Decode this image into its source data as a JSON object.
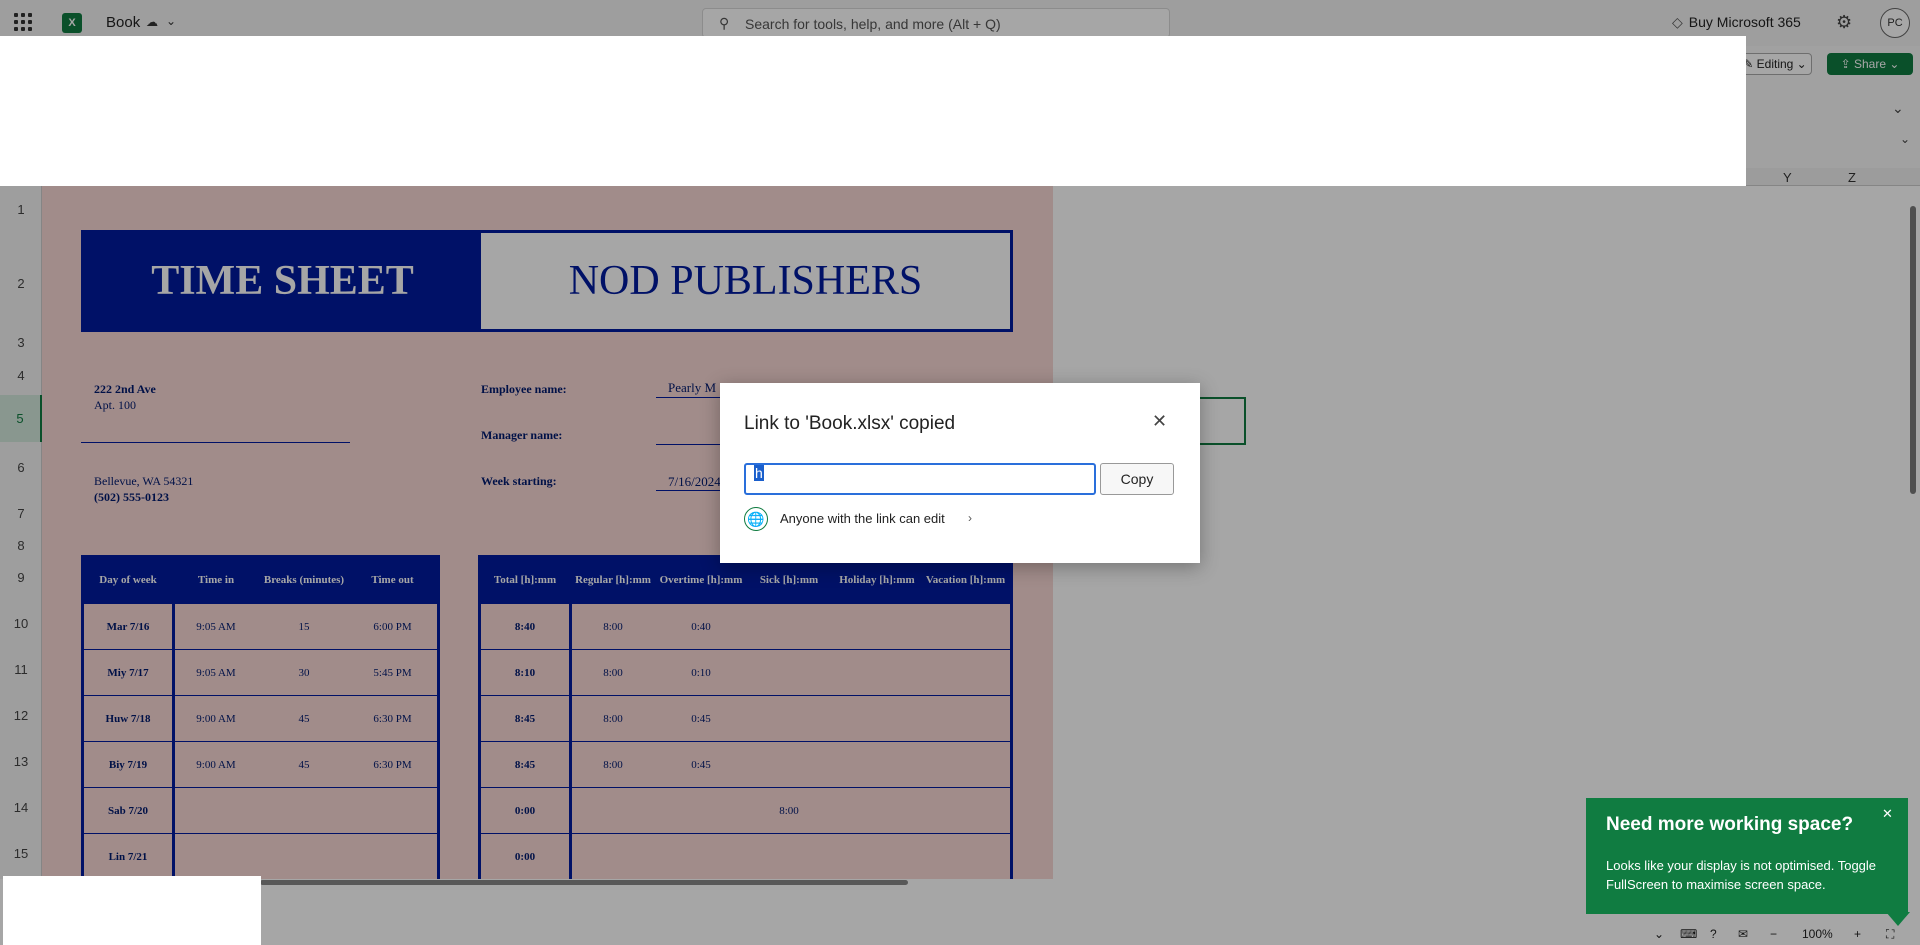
{
  "topbar": {
    "app_logo": "X",
    "book_title": "Book",
    "search_placeholder": "Search for tools, help, and more (Alt + Q)",
    "buy_label": "Buy Microsoft 365",
    "avatar": "PC"
  },
  "ribbon": {
    "editing_label": "Editing",
    "share_label": "Share"
  },
  "columns": [
    "Y",
    "Z"
  ],
  "rows": [
    "1",
    "2",
    "3",
    "4",
    "5",
    "6",
    "7",
    "8",
    "9",
    "10",
    "11",
    "12",
    "13",
    "14",
    "15"
  ],
  "sheet": {
    "title_left": "TIME SHEET",
    "title_right": "NOD PUBLISHERS",
    "address1": "222 2nd Ave",
    "address2": "Apt. 100",
    "city": "Bellevue, WA 54321",
    "phone": "(502) 555-0123",
    "employee_label": "Employee name:",
    "employee_value": "Pearly M",
    "manager_label": "Manager name:",
    "week_label": "Week starting:",
    "week_value": "7/16/2024",
    "left_headers": [
      "Day of week",
      "Time in",
      "Breaks (minutes)",
      "Time out"
    ],
    "right_headers": [
      "Total [h]:mm",
      "Regular [h]:mm",
      "Overtime [h]:mm",
      "Sick [h]:mm",
      "Holiday [h]:mm",
      "Vacation [h]:mm"
    ],
    "left_rows": [
      [
        "Mar 7/16",
        "9:05 AM",
        "15",
        "6:00 PM"
      ],
      [
        "Miy 7/17",
        "9:05 AM",
        "30",
        "5:45 PM"
      ],
      [
        "Huw 7/18",
        "9:00 AM",
        "45",
        "6:30 PM"
      ],
      [
        "Biy 7/19",
        "9:00 AM",
        "45",
        "6:30 PM"
      ],
      [
        "Sab 7/20",
        "",
        "",
        ""
      ],
      [
        "Lin 7/21",
        "",
        "",
        ""
      ]
    ],
    "right_rows": [
      [
        "8:40",
        "8:00",
        "0:40",
        "",
        "",
        ""
      ],
      [
        "8:10",
        "8:00",
        "0:10",
        "",
        "",
        ""
      ],
      [
        "8:45",
        "8:00",
        "0:45",
        "",
        "",
        ""
      ],
      [
        "8:45",
        "8:00",
        "0:45",
        "",
        "",
        ""
      ],
      [
        "0:00",
        "",
        "",
        "8:00",
        "",
        ""
      ],
      [
        "0:00",
        "",
        "",
        "",
        "",
        ""
      ]
    ]
  },
  "dialog": {
    "title": "Link to 'Book.xlsx' copied",
    "link_value": "h",
    "copy_label": "Copy",
    "permission": "Anyone with the link can edit"
  },
  "toast": {
    "title": "Need more working space?",
    "body": "Looks like your display is not optimised. Toggle FullScreen to maximise screen space."
  },
  "status": {
    "zoom": "100%"
  }
}
